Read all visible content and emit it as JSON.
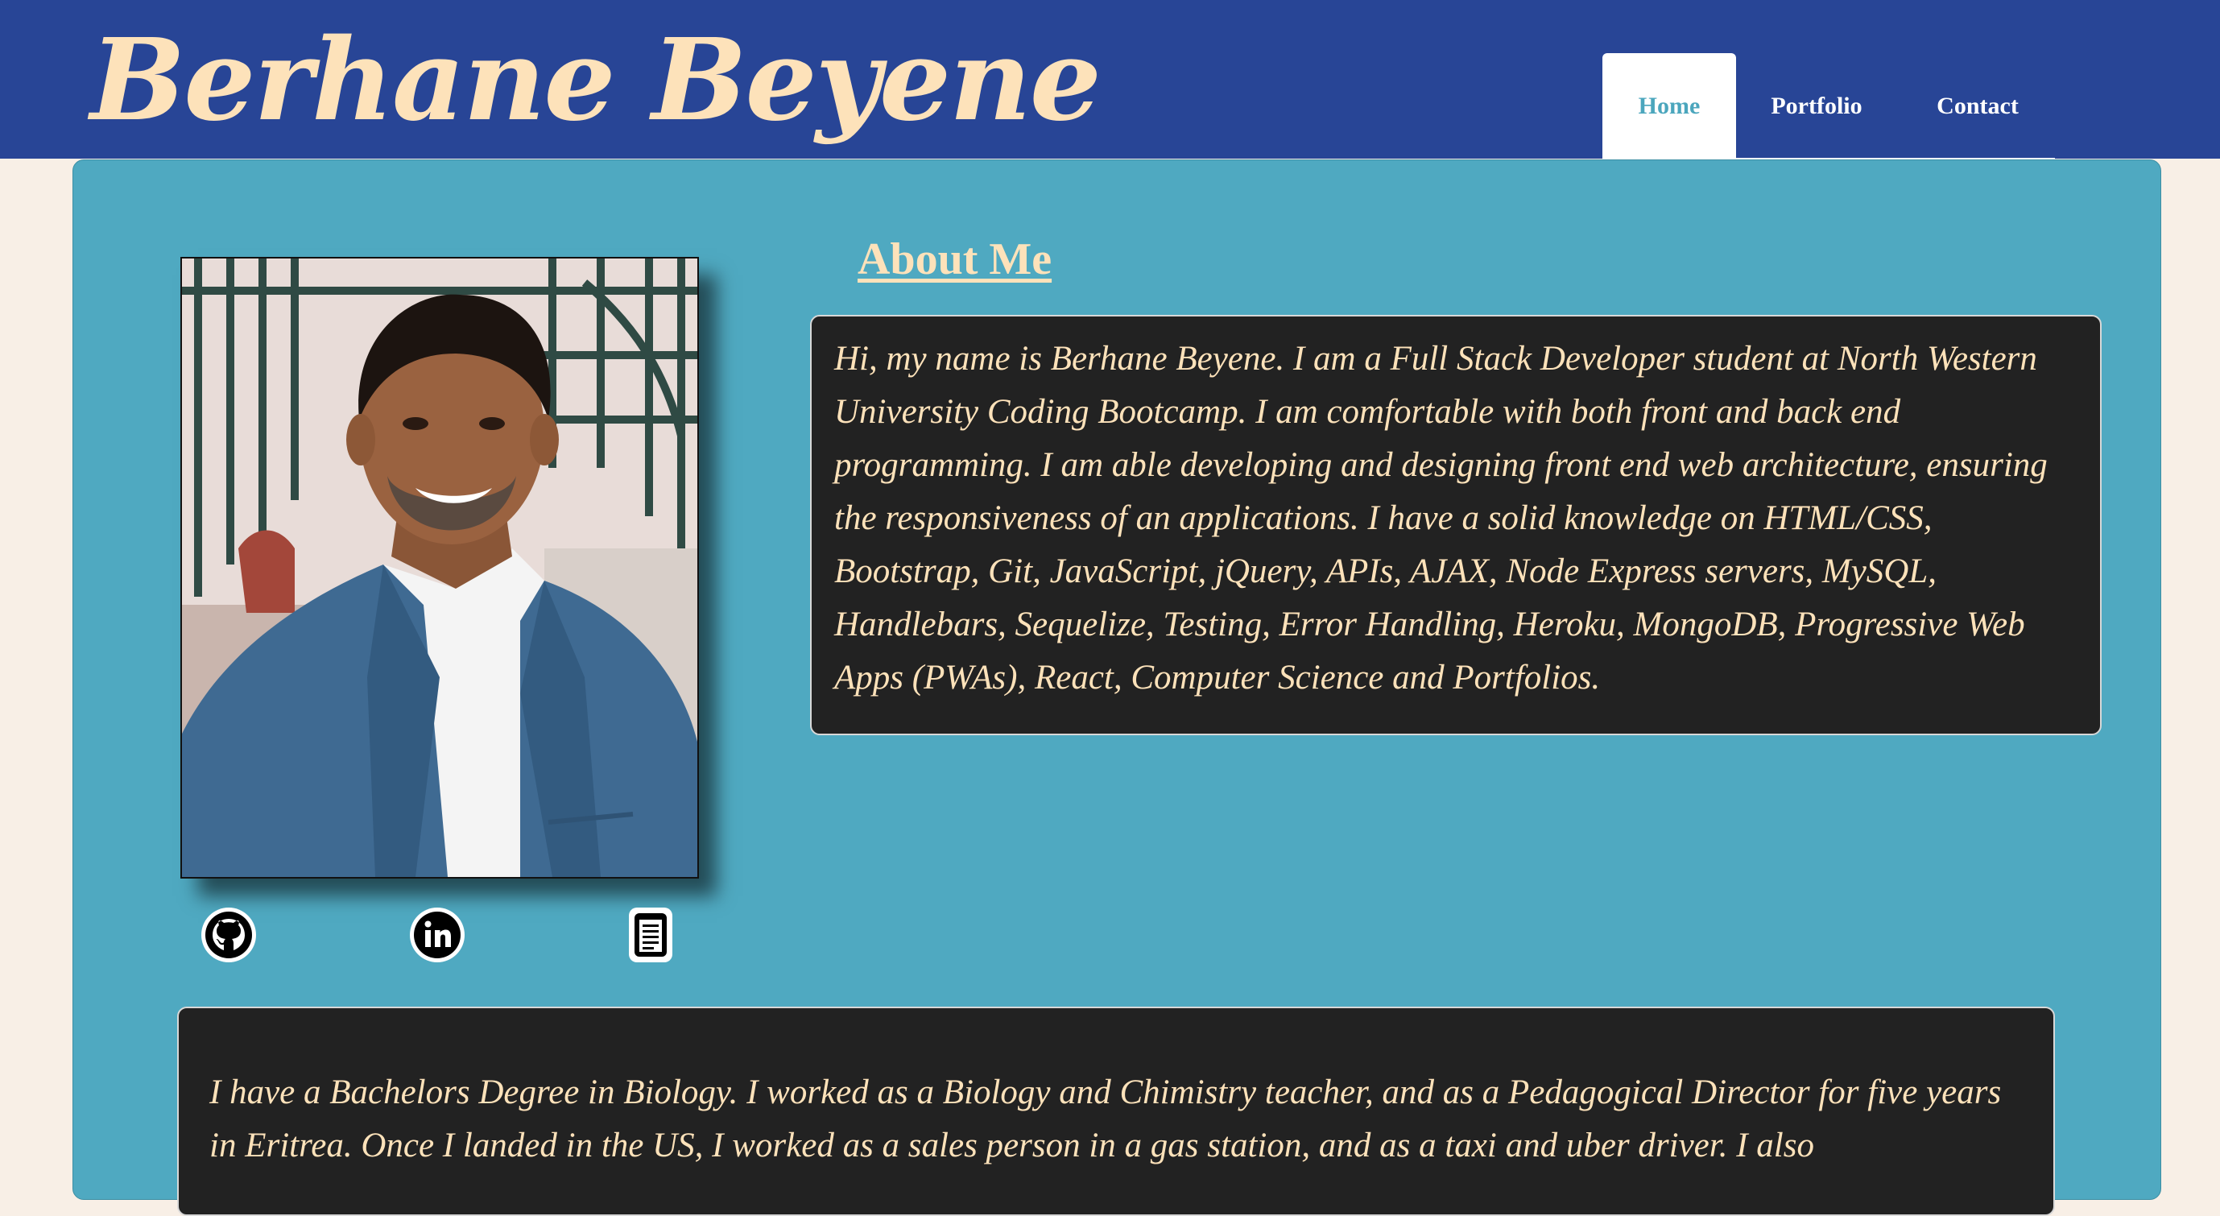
{
  "header": {
    "site_title": "Berhane Beyene",
    "nav": [
      {
        "label": "Home",
        "active": true
      },
      {
        "label": "Portfolio",
        "active": false
      },
      {
        "label": "Contact",
        "active": false
      }
    ]
  },
  "colors": {
    "header_bg": "#284596",
    "title_text": "#fde2ba",
    "panel_bg": "#4fa9c1",
    "text_box_bg": "#222222",
    "page_bg": "#f8efe6",
    "active_nav_text": "#4ba6bd"
  },
  "profile": {
    "photo": "profile-photo",
    "social_links": [
      {
        "icon": "github-icon"
      },
      {
        "icon": "linkedin-icon"
      },
      {
        "icon": "resume-document-icon"
      }
    ]
  },
  "about": {
    "heading": "About Me",
    "text": "Hi, my name is Berhane Beyene. I am a Full Stack Developer student at North Western University Coding Bootcamp. I am comfortable with both front and back end programming. I am able developing and designing front end web architecture, ensuring the responsiveness of an applications. I have a solid knowledge on HTML/CSS, Bootstrap, Git, JavaScript, jQuery, APIs, AJAX, Node Express servers, MySQL, Handlebars, Sequelize, Testing, Error Handling, Heroku, MongoDB, Progressive Web Apps (PWAs), React, Computer Science and Portfolios."
  },
  "bio": {
    "text": "I have a Bachelors Degree in Biology. I worked as a Biology and Chimistry teacher, and as a Pedagogical Director for five years in Eritrea. Once I landed in the US, I worked as a sales person in a gas station, and as a taxi and uber driver. I also"
  }
}
